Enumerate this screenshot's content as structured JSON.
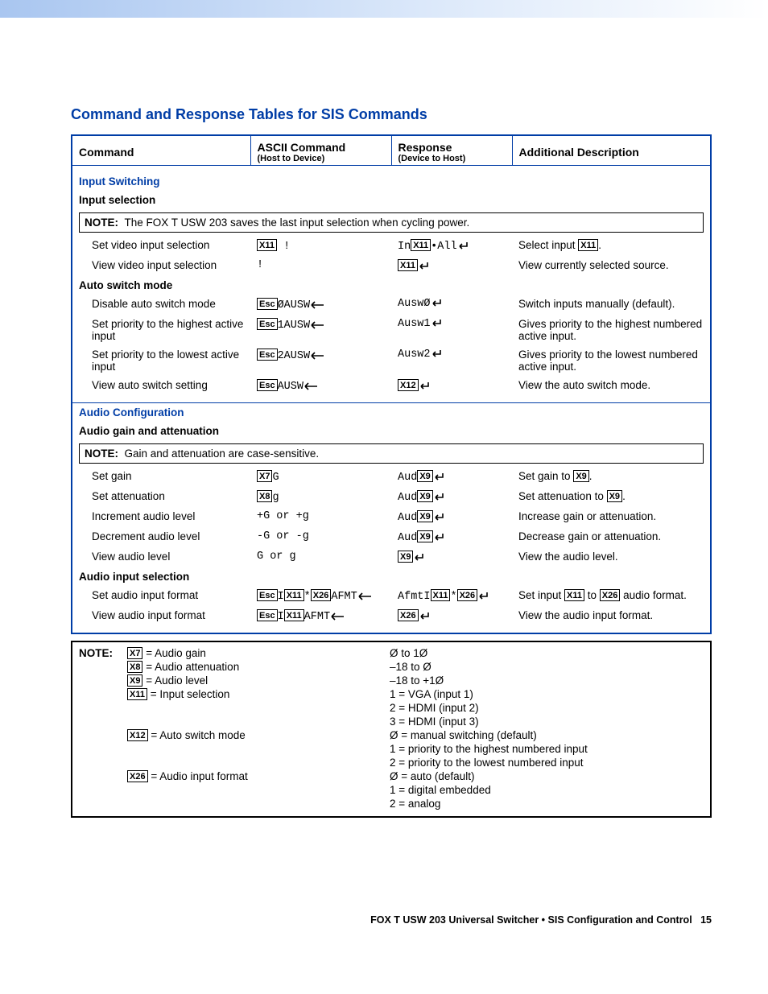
{
  "page_title": "Command and Response Tables for SIS Commands",
  "headers": {
    "cmd": "Command",
    "ascii": "ASCII Command",
    "ascii_sub": "(Host to Device)",
    "resp": "Response",
    "resp_sub": "(Device to Host)",
    "desc": "Additional Description"
  },
  "groups": {
    "input_switching": "Input Switching",
    "input_selection": "Input selection",
    "auto_switch": "Auto switch mode",
    "audio_config": "Audio Configuration",
    "audio_gain_att": "Audio gain and attenuation",
    "audio_input_sel": "Audio input selection"
  },
  "notes": {
    "n1_label": "NOTE:",
    "n1_text": "The FOX T USW 203 saves the last input selection when cycling power.",
    "n2_label": "NOTE:",
    "n2_text": "Gain and attenuation are case-sensitive.",
    "n3_label": "NOTE:"
  },
  "rows": {
    "set_video": {
      "cmd": "Set video input selection",
      "ascii_post": " !",
      "r_pre": "In",
      "r_mid": "•All",
      "d_pre": "Select input ",
      "d_post": "."
    },
    "view_video": {
      "cmd": "View video input selection",
      "ascii": "!",
      "desc": "View currently selected source."
    },
    "disable_auto": {
      "cmd": "Disable auto switch mode",
      "ascii": "ØAUSW",
      "resp": "AuswØ",
      "desc": "Switch inputs manually (default)."
    },
    "pri_high": {
      "cmd": "Set priority to the highest active input",
      "ascii": "1AUSW",
      "resp": "Ausw1",
      "desc": "Gives priority to the highest numbered active input."
    },
    "pri_low": {
      "cmd": "Set priority to the lowest active input",
      "ascii": "2AUSW",
      "resp": "Ausw2",
      "desc": "Gives priority to the lowest numbered active input."
    },
    "view_auto": {
      "cmd": "View auto switch setting",
      "ascii": "AUSW",
      "desc": "View the auto switch mode."
    },
    "set_gain": {
      "cmd": "Set gain",
      "ascii_post": "G",
      "r_pre": "Aud",
      "d_pre": "Set gain to ",
      "d_post": "."
    },
    "set_att": {
      "cmd": "Set attenuation",
      "ascii_post": "g",
      "r_pre": "Aud",
      "d_pre": "Set attenuation to ",
      "d_post": "."
    },
    "inc_lvl": {
      "cmd": "Increment audio level",
      "ascii": "+G or +g",
      "r_pre": "Aud",
      "desc": "Increase gain or attenuation."
    },
    "dec_lvl": {
      "cmd": "Decrement audio level",
      "ascii": "-G or -g",
      "r_pre": "Aud",
      "desc": "Decrease gain or attenuation."
    },
    "view_lvl": {
      "cmd": "View audio level",
      "ascii": "G or g",
      "desc": "View the audio level."
    },
    "set_afmt": {
      "cmd": "Set audio input format",
      "a_pre": "I",
      "a_mid": "*",
      "a_post": "AFMT",
      "r_pre": "AfmtI",
      "r_mid": "*",
      "d_pre": "Set input ",
      "d_mid": " to ",
      "d_post": " audio format."
    },
    "view_afmt": {
      "cmd": "View audio input format",
      "a_pre": "I",
      "a_post": "AFMT",
      "desc": "View the audio input format."
    }
  },
  "vars": {
    "esc": "Esc",
    "x7": "X7",
    "x8": "X8",
    "x9": "X9",
    "x11": "X11",
    "x12": "X12",
    "x26": "X26"
  },
  "defs": {
    "r1": {
      "l": " = Audio gain",
      "r": "Ø to 1Ø"
    },
    "r2": {
      "l": " = Audio attenuation",
      "r": "–18 to Ø"
    },
    "r3": {
      "l": " = Audio level",
      "r": "–18 to +1Ø"
    },
    "r4": {
      "l": " = Input selection",
      "r1": "1 = VGA (input 1)",
      "r2": "2 = HDMI (input 2)",
      "r3": "3 = HDMI (input 3)"
    },
    "r5": {
      "l": " = Auto switch mode",
      "r1": "Ø = manual switching (default)",
      "r2": "1 = priority to the highest numbered input",
      "r3": "2 = priority to the lowest numbered input"
    },
    "r6": {
      "l": " = Audio input format",
      "r1": "Ø = auto (default)",
      "r2": "1 = digital embedded",
      "r3": "2 = analog"
    }
  },
  "footer": {
    "bold": "FOX T USW 203 Universal Switcher • SIS Configuration and Control",
    "num": "15"
  }
}
